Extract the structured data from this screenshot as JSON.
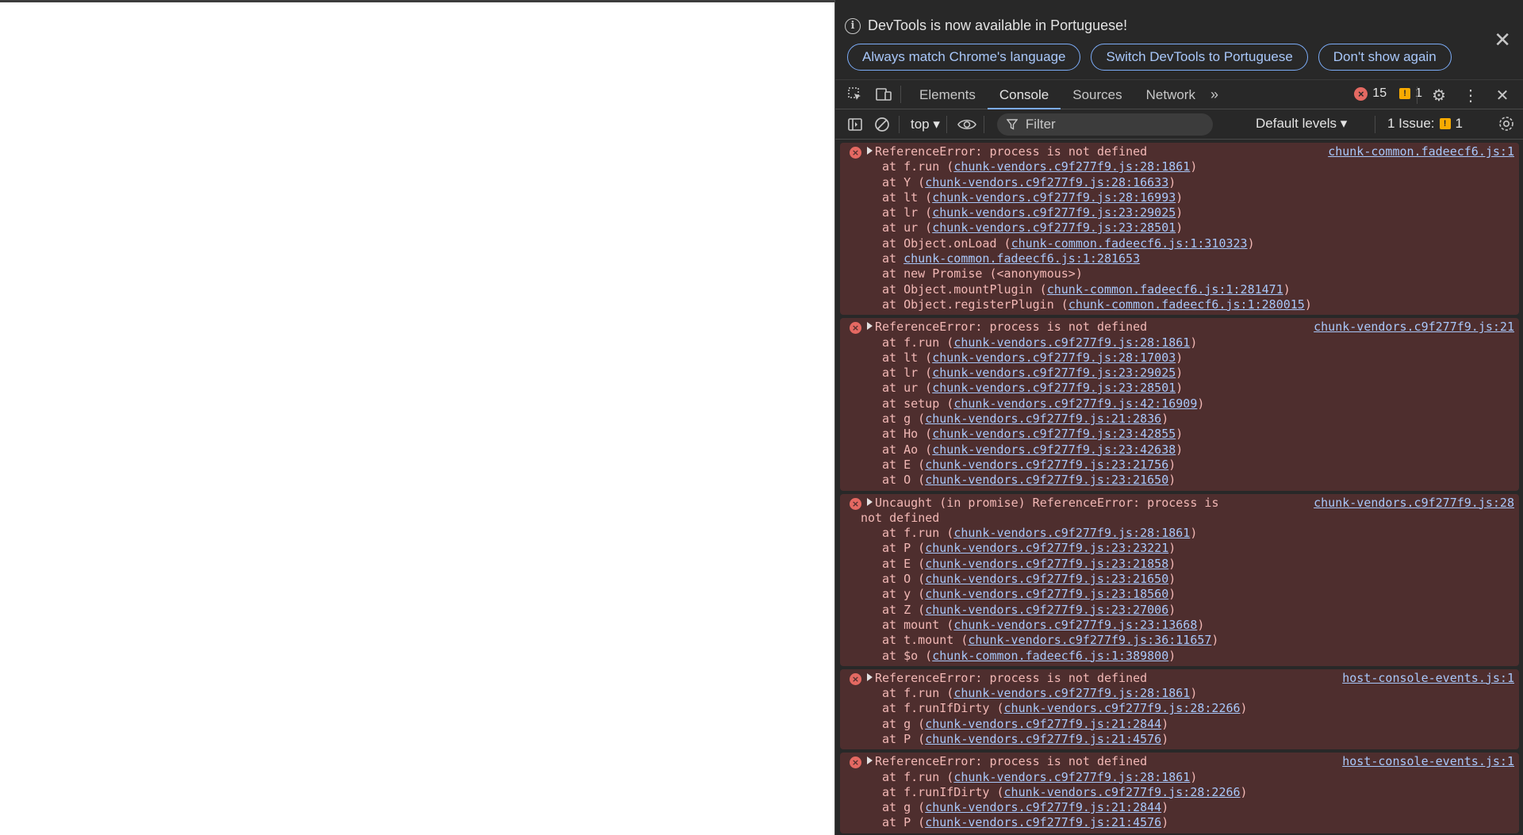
{
  "infobar": {
    "message": "DevTools is now available in Portuguese!",
    "buttons": [
      "Always match Chrome's language",
      "Switch DevTools to Portuguese",
      "Don't show again"
    ]
  },
  "toolbar": {
    "tabs": [
      "Elements",
      "Console",
      "Sources",
      "Network"
    ],
    "active_tab": "Console",
    "error_count": "15",
    "warning_count": "1"
  },
  "console_toolbar": {
    "context": "top",
    "filter_placeholder": "Filter",
    "levels": "Default levels",
    "issues_label": "1 Issue:",
    "issues_count": "1"
  },
  "messages": [
    {
      "text": "ReferenceError: process is not defined",
      "source": "chunk-common.fadeecf6.js:1",
      "frames": [
        {
          "pre": "at f.run (",
          "link": "chunk-vendors.c9f277f9.js:28:1861",
          "post": ")"
        },
        {
          "pre": "at Y (",
          "link": "chunk-vendors.c9f277f9.js:28:16633",
          "post": ")"
        },
        {
          "pre": "at lt (",
          "link": "chunk-vendors.c9f277f9.js:28:16993",
          "post": ")"
        },
        {
          "pre": "at lr (",
          "link": "chunk-vendors.c9f277f9.js:23:29025",
          "post": ")"
        },
        {
          "pre": "at ur (",
          "link": "chunk-vendors.c9f277f9.js:23:28501",
          "post": ")"
        },
        {
          "pre": "at Object.onLoad (",
          "link": "chunk-common.fadeecf6.js:1:310323",
          "post": ")"
        },
        {
          "pre": "at ",
          "link": "chunk-common.fadeecf6.js:1:281653",
          "post": ""
        },
        {
          "pre": "at new Promise (<anonymous>)",
          "link": "",
          "post": ""
        },
        {
          "pre": "at Object.mountPlugin (",
          "link": "chunk-common.fadeecf6.js:1:281471",
          "post": ")"
        },
        {
          "pre": "at Object.registerPlugin (",
          "link": "chunk-common.fadeecf6.js:1:280015",
          "post": ")"
        }
      ]
    },
    {
      "text": "ReferenceError: process is not defined",
      "source": "chunk-vendors.c9f277f9.js:21",
      "frames": [
        {
          "pre": "at f.run (",
          "link": "chunk-vendors.c9f277f9.js:28:1861",
          "post": ")"
        },
        {
          "pre": "at lt (",
          "link": "chunk-vendors.c9f277f9.js:28:17003",
          "post": ")"
        },
        {
          "pre": "at lr (",
          "link": "chunk-vendors.c9f277f9.js:23:29025",
          "post": ")"
        },
        {
          "pre": "at ur (",
          "link": "chunk-vendors.c9f277f9.js:23:28501",
          "post": ")"
        },
        {
          "pre": "at setup (",
          "link": "chunk-vendors.c9f277f9.js:42:16909",
          "post": ")"
        },
        {
          "pre": "at g (",
          "link": "chunk-vendors.c9f277f9.js:21:2836",
          "post": ")"
        },
        {
          "pre": "at Ho (",
          "link": "chunk-vendors.c9f277f9.js:23:42855",
          "post": ")"
        },
        {
          "pre": "at Ao (",
          "link": "chunk-vendors.c9f277f9.js:23:42638",
          "post": ")"
        },
        {
          "pre": "at E (",
          "link": "chunk-vendors.c9f277f9.js:23:21756",
          "post": ")"
        },
        {
          "pre": "at O (",
          "link": "chunk-vendors.c9f277f9.js:23:21650",
          "post": ")"
        }
      ]
    },
    {
      "text": "Uncaught (in promise) ReferenceError: process is",
      "text2": "not defined",
      "source": "chunk-vendors.c9f277f9.js:28",
      "frames": [
        {
          "pre": "at f.run (",
          "link": "chunk-vendors.c9f277f9.js:28:1861",
          "post": ")"
        },
        {
          "pre": "at P (",
          "link": "chunk-vendors.c9f277f9.js:23:23221",
          "post": ")"
        },
        {
          "pre": "at E (",
          "link": "chunk-vendors.c9f277f9.js:23:21858",
          "post": ")"
        },
        {
          "pre": "at O (",
          "link": "chunk-vendors.c9f277f9.js:23:21650",
          "post": ")"
        },
        {
          "pre": "at y (",
          "link": "chunk-vendors.c9f277f9.js:23:18560",
          "post": ")"
        },
        {
          "pre": "at Z (",
          "link": "chunk-vendors.c9f277f9.js:23:27006",
          "post": ")"
        },
        {
          "pre": "at mount (",
          "link": "chunk-vendors.c9f277f9.js:23:13668",
          "post": ")"
        },
        {
          "pre": "at t.mount (",
          "link": "chunk-vendors.c9f277f9.js:36:11657",
          "post": ")"
        },
        {
          "pre": "at $o (",
          "link": "chunk-common.fadeecf6.js:1:389800",
          "post": ")"
        }
      ]
    },
    {
      "text": "ReferenceError: process is not defined",
      "source": "host-console-events.js:1",
      "frames": [
        {
          "pre": "at f.run (",
          "link": "chunk-vendors.c9f277f9.js:28:1861",
          "post": ")"
        },
        {
          "pre": "at f.runIfDirty (",
          "link": "chunk-vendors.c9f277f9.js:28:2266",
          "post": ")"
        },
        {
          "pre": "at g (",
          "link": "chunk-vendors.c9f277f9.js:21:2844",
          "post": ")"
        },
        {
          "pre": "at P (",
          "link": "chunk-vendors.c9f277f9.js:21:4576",
          "post": ")"
        }
      ]
    },
    {
      "text": "ReferenceError: process is not defined",
      "source": "host-console-events.js:1",
      "frames": [
        {
          "pre": "at f.run (",
          "link": "chunk-vendors.c9f277f9.js:28:1861",
          "post": ")"
        },
        {
          "pre": "at f.runIfDirty (",
          "link": "chunk-vendors.c9f277f9.js:28:2266",
          "post": ")"
        },
        {
          "pre": "at g (",
          "link": "chunk-vendors.c9f277f9.js:21:2844",
          "post": ")"
        },
        {
          "pre": "at P (",
          "link": "chunk-vendors.c9f277f9.js:21:4576",
          "post": ")"
        }
      ]
    }
  ]
}
